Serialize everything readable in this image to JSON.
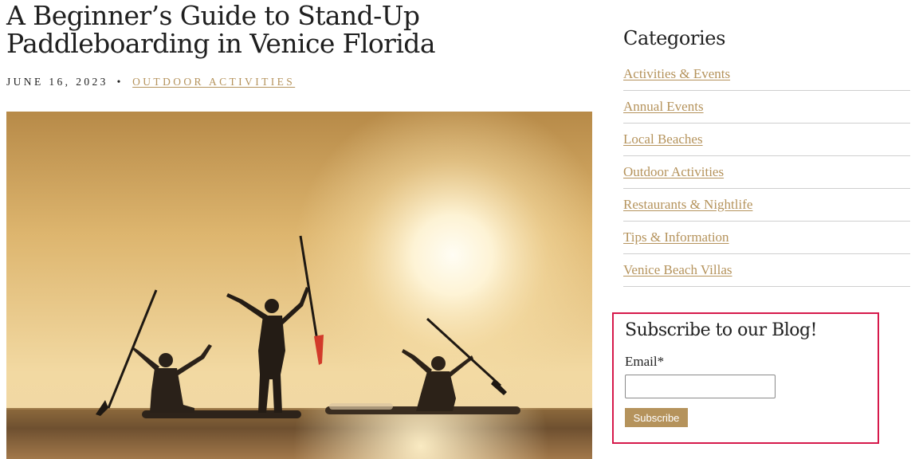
{
  "post": {
    "title": "A Beginner’s Guide to Stand-Up Paddleboarding in Venice Florida",
    "date": "JUNE 16, 2023",
    "separator": "•",
    "category": "OUTDOOR ACTIVITIES",
    "image": "sunset paddleboarders silhouette"
  },
  "sidebar": {
    "categories_heading": "Categories",
    "categories": [
      {
        "label": "Activities & Events"
      },
      {
        "label": "Annual Events"
      },
      {
        "label": "Local Beaches"
      },
      {
        "label": "Outdoor Activities"
      },
      {
        "label": "Restaurants & Nightlife"
      },
      {
        "label": "Tips & Information"
      },
      {
        "label": "Venice Beach Villas"
      }
    ],
    "subscribe": {
      "title": "Subscribe to our Blog!",
      "email_label": "Email*",
      "email_value": "",
      "button_label": "Subscribe"
    }
  },
  "colors": {
    "accent": "#b5935c",
    "highlight_border": "#d6194b",
    "text": "#222222"
  }
}
